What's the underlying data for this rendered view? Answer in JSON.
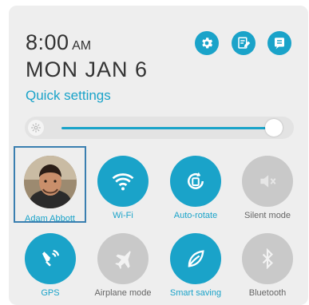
{
  "clock": {
    "time": "8:00",
    "ampm": "AM",
    "date": "MON JAN 6"
  },
  "section_title": "Quick settings",
  "brightness": {
    "level": 0.96
  },
  "user": {
    "name": "Adam Abbott"
  },
  "tiles": [
    {
      "label": "Wi-Fi",
      "state": "on",
      "icon": "wifi-icon"
    },
    {
      "label": "Auto-rotate",
      "state": "on",
      "icon": "auto-rotate-icon"
    },
    {
      "label": "Silent mode",
      "state": "off",
      "icon": "speaker-mute-icon"
    },
    {
      "label": "GPS",
      "state": "on",
      "icon": "gps-icon"
    },
    {
      "label": "Airplane mode",
      "state": "off",
      "icon": "airplane-icon"
    },
    {
      "label": "Smart saving",
      "state": "on",
      "icon": "leaf-icon"
    },
    {
      "label": "Bluetooth",
      "state": "off",
      "icon": "bluetooth-icon"
    }
  ],
  "colors": {
    "accent": "#1aa3c9",
    "off": "#c9c9c9",
    "panel": "#eeeeee"
  }
}
